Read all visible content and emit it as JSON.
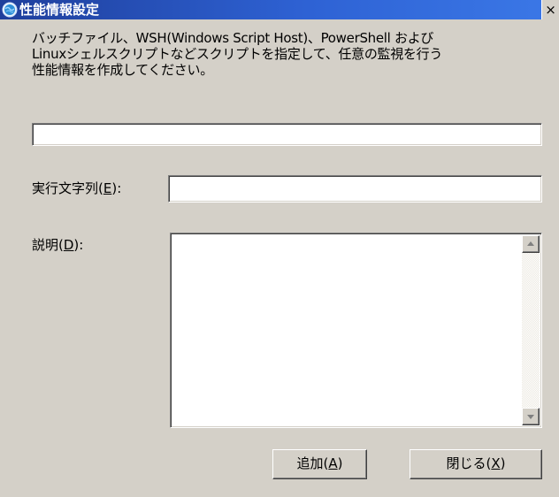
{
  "window": {
    "title": "性能情報設定",
    "close_label": "×"
  },
  "description": {
    "lines": [
      "バッチファイル、WSH(Windows Script Host)、PowerShell および",
      "Linuxシェルスクリプトなどスクリプトを指定して、任意の監視を行う",
      "性能情報を作成してください。"
    ]
  },
  "fields": {
    "top_input_value": "",
    "command": {
      "label_prefix": "実行文字列(",
      "label_key": "E",
      "label_suffix": "):",
      "value": ""
    },
    "description": {
      "label_prefix": "説明(",
      "label_key": "D",
      "label_suffix": "):",
      "value": ""
    }
  },
  "buttons": {
    "add": {
      "prefix": "追加(",
      "key": "A",
      "suffix": ")"
    },
    "close": {
      "prefix": "閉じる(",
      "key": "X",
      "suffix": ")"
    }
  },
  "icons": {
    "title": "monitor-globe-icon",
    "close": "close-icon",
    "scroll_up": "scroll-up-arrow-icon",
    "scroll_down": "scroll-down-arrow-icon"
  },
  "colors": {
    "titlebar": "#2e62d4",
    "dialog_face": "#d4d0c8",
    "field_bg": "#ffffff"
  }
}
